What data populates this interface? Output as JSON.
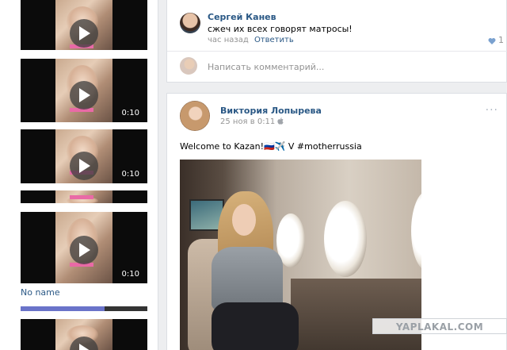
{
  "left_column": {
    "videos": [
      {
        "duration": ""
      },
      {
        "duration": "0:10"
      },
      {
        "duration": "0:10"
      },
      {
        "duration": ""
      },
      {
        "duration": "0:10"
      },
      {
        "duration": ""
      }
    ],
    "no_name_label": "No name",
    "progress": 0.66
  },
  "comment": {
    "author": "Сергей Канев",
    "text": "сжеч их всех говорят матросы!",
    "time": "час назад",
    "reply_label": "Ответить",
    "likes": "1"
  },
  "comment_input": {
    "placeholder": "Написать комментарий..."
  },
  "post": {
    "author": "Виктория Лопырева",
    "date": "25 ноя в 0:11",
    "text": "Welcome to Kazan!🇷🇺✈️ V #motherrussia",
    "menu": "···"
  },
  "watermark": "YAPLAKAL.COM",
  "colors": {
    "link": "#2a5885",
    "background": "#edeef0",
    "meta": "#939393"
  },
  "icons": [
    "play-icon",
    "heart-icon",
    "apple-icon",
    "more-icon"
  ]
}
